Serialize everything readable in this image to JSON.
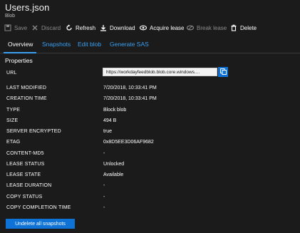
{
  "header": {
    "title": "Users.json",
    "subtitle": "Blob"
  },
  "toolbar": {
    "save": "Save",
    "discard": "Discard",
    "refresh": "Refresh",
    "download": "Download",
    "acquire_lease": "Acquire lease",
    "break_lease": "Break lease",
    "delete": "Delete"
  },
  "tabs": [
    "Overview",
    "Snapshots",
    "Edit blob",
    "Generate SAS"
  ],
  "properties": {
    "title": "Properties",
    "url_label": "URL",
    "url_value": "https://workdayfeedblob.blob.core.windows....",
    "rows": [
      {
        "label": "LAST MODIFIED",
        "value": "7/20/2018, 10:33:41 PM"
      },
      {
        "label": "CREATION TIME",
        "value": "7/20/2018, 10:33:41 PM"
      },
      {
        "label": "TYPE",
        "value": "Block blob"
      },
      {
        "label": "SIZE",
        "value": "494 B"
      },
      {
        "label": "SERVER ENCRYPTED",
        "value": "true"
      },
      {
        "label": "ETAG",
        "value": "0x8D5EE3D06AF9682"
      },
      {
        "label": "CONTENT-MD5",
        "value": "-"
      },
      {
        "label": "LEASE STATUS",
        "value": "Unlocked"
      },
      {
        "label": "LEASE STATE",
        "value": "Available"
      },
      {
        "label": "LEASE DURATION",
        "value": "-"
      },
      {
        "label": "COPY STATUS",
        "value": "-"
      },
      {
        "label": "COPY COMPLETION TIME",
        "value": "-"
      }
    ]
  },
  "actions": {
    "undelete_snapshots": "Undelete all snapshots"
  },
  "colors": {
    "accent": "#0f72d6",
    "link": "#3aa0f3",
    "background": "#1b1b1b",
    "disabled": "#8a8a8a"
  }
}
